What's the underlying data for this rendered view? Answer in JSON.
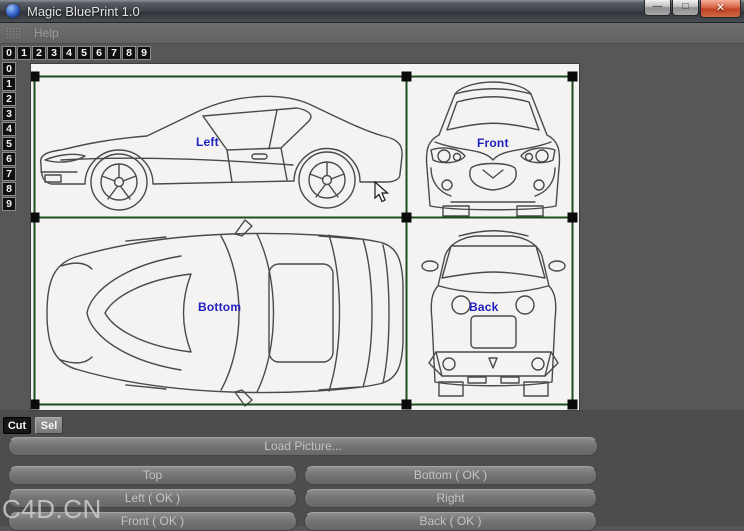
{
  "window": {
    "title": "Magic BluePrint 1.0"
  },
  "icons": {
    "minimize": "—",
    "maximize": "□",
    "close": "✕"
  },
  "menu": {
    "help_label": "Help"
  },
  "rulers": {
    "top": [
      "0",
      "1",
      "2",
      "3",
      "4",
      "5",
      "6",
      "7",
      "8",
      "9"
    ],
    "left": [
      "0",
      "1",
      "2",
      "3",
      "4",
      "5",
      "6",
      "7",
      "8",
      "9"
    ]
  },
  "canvas": {
    "views": [
      {
        "id": "left",
        "label": "Left"
      },
      {
        "id": "front",
        "label": "Front"
      },
      {
        "id": "bottom",
        "label": "Bottom"
      },
      {
        "id": "back",
        "label": "Back"
      }
    ],
    "colors": {
      "selection_green": "#1e4d1e",
      "label_blue": "#2020c0",
      "canvas_white": "#f4f3f1",
      "blueprint_line_gray": "#4a4a4a"
    }
  },
  "tools": {
    "cut_label": "Cut",
    "sel_label": "Sel"
  },
  "actions": {
    "load_label": "Load Picture...",
    "grid": [
      [
        "Top",
        "Bottom ( OK )"
      ],
      [
        "Left ( OK )",
        "Right"
      ],
      [
        "Front ( OK )",
        "Back ( OK )"
      ]
    ]
  },
  "watermark": "C4D.CN",
  "theme": {
    "close_button_red": "#bf4228",
    "background_gray": "#575757",
    "bottom_panel_gray": "#4d4d4d",
    "titlebar_gray": "#3f434b"
  }
}
